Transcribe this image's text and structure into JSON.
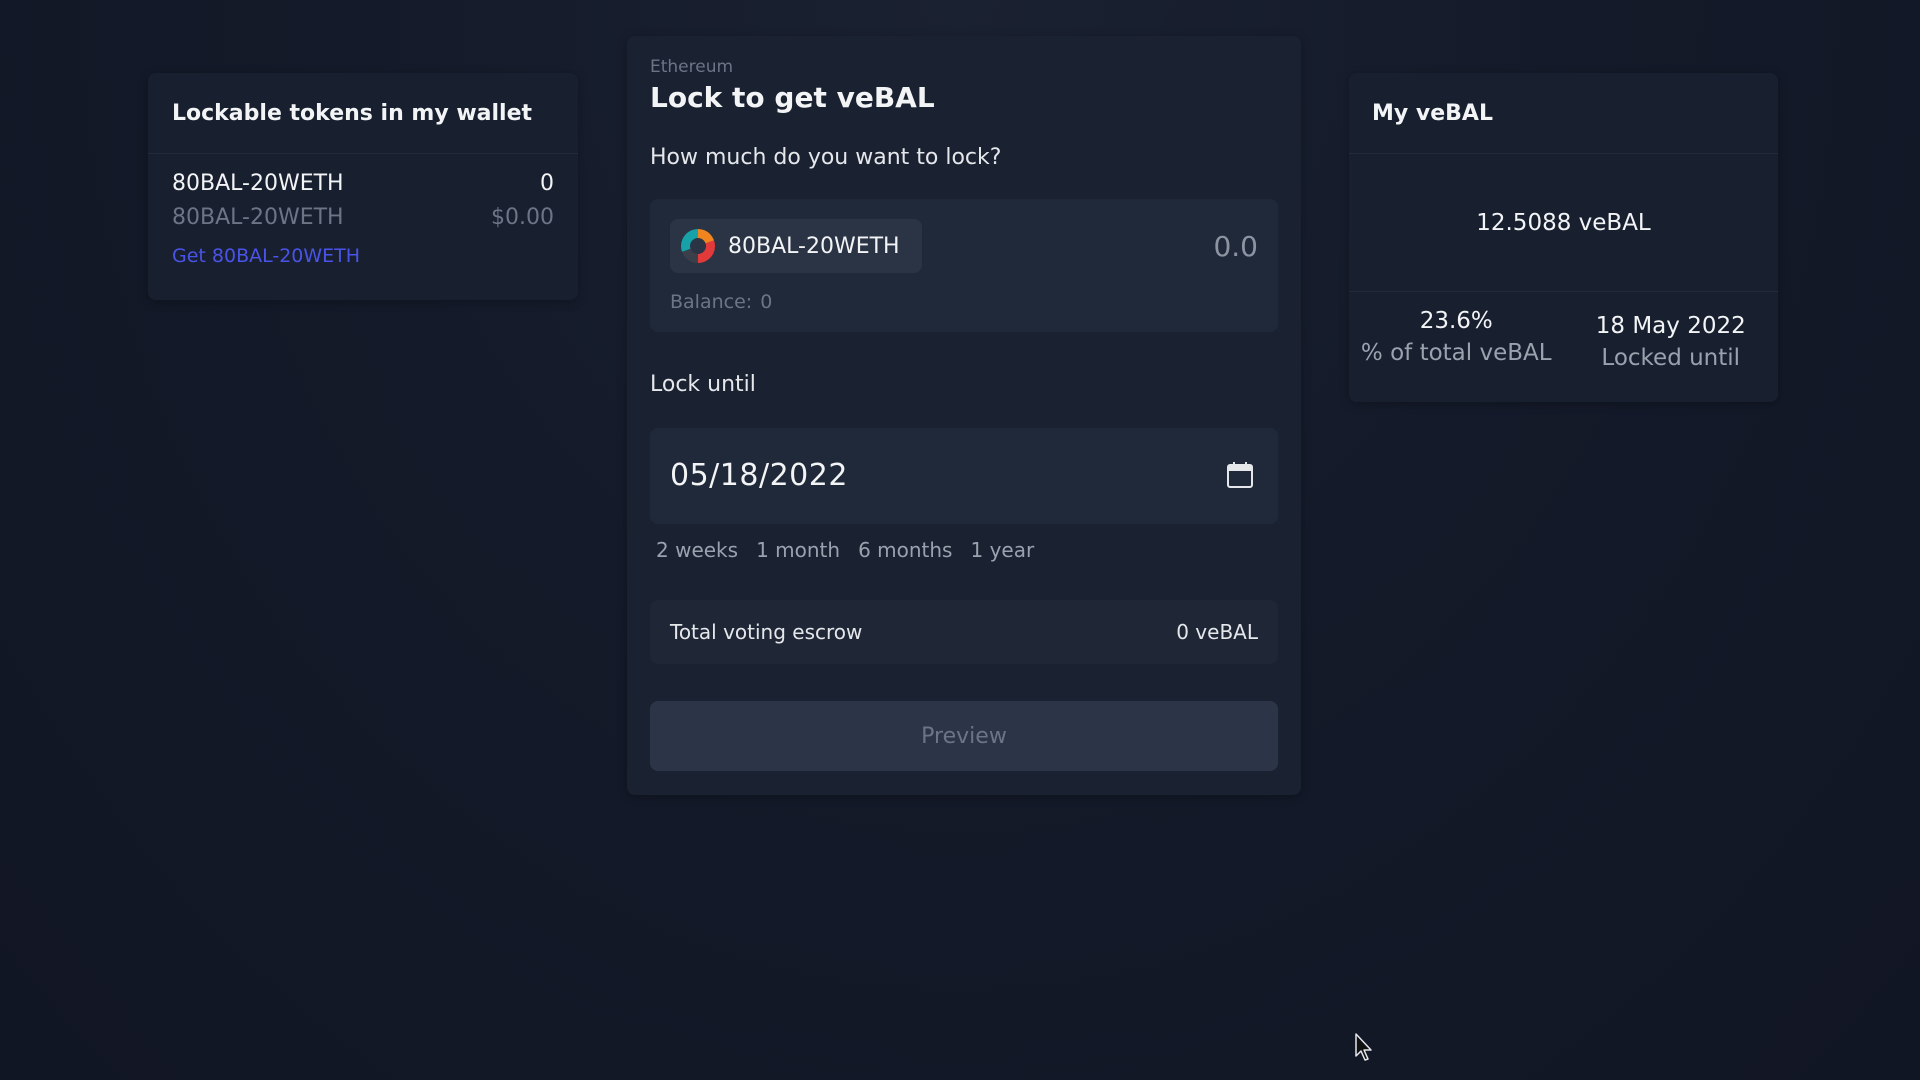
{
  "wallet": {
    "title": "Lockable tokens in my wallet",
    "token_name": "80BAL-20WETH",
    "token_amount": "0",
    "token_name_secondary": "80BAL-20WETH",
    "token_value": "$0.00",
    "get_link": "Get 80BAL-20WETH"
  },
  "lock": {
    "network": "Ethereum",
    "title": "Lock to get veBAL",
    "question": "How much do you want to lock?",
    "token": {
      "name": "80BAL-20WETH",
      "icon": "token-logo-icon",
      "amount_placeholder": "0.0",
      "balance_label": "Balance:",
      "balance_value": "0"
    },
    "lock_until_label": "Lock until",
    "date_value": "05/18/2022",
    "calendar_icon": "calendar-icon",
    "presets": [
      "2 weeks",
      "1 month",
      "6 months",
      "1 year"
    ],
    "escrow_label": "Total voting escrow",
    "escrow_value": "0 veBAL",
    "preview_label": "Preview"
  },
  "my_vebal": {
    "title": "My veBAL",
    "total": "12.5088 veBAL",
    "percent_value": "23.6%",
    "percent_label": "% of total veBAL",
    "locked_value": "18 May 2022",
    "locked_label": "Locked until"
  },
  "colors": {
    "background": "#121827",
    "card": "#182030",
    "link": "#4a53e8",
    "muted": "#6b7585"
  }
}
